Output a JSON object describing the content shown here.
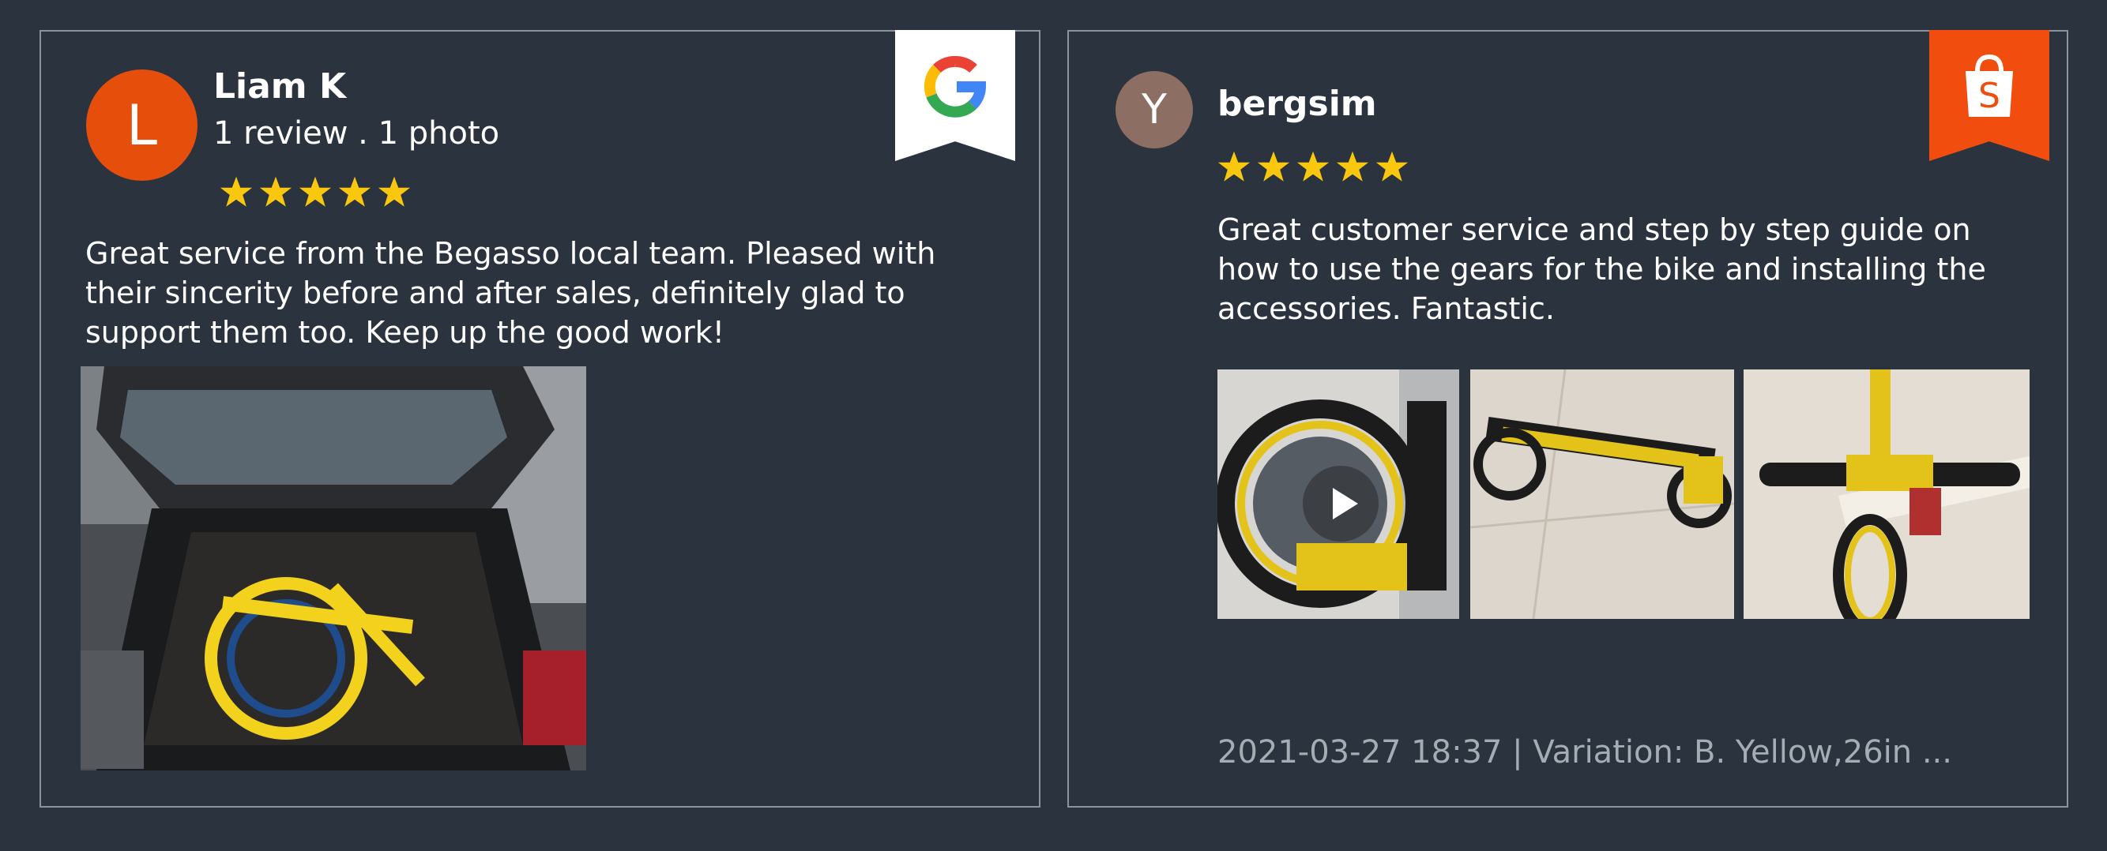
{
  "reviews": {
    "left": {
      "platform": "google",
      "avatar_letter": "L",
      "avatar_color": "#e64e0c",
      "name": "Liam K",
      "meta": "1 review . 1 photo",
      "rating": 5,
      "text": "Great service from the Begasso local team. Pleased with their sincerity before and after sales, definitely glad to support them too. Keep up the good work!",
      "photo": "photo of folded yellow bicycle in car trunk"
    },
    "right": {
      "platform": "shopee",
      "avatar_letter": "Y",
      "avatar_color": "#8c6e63",
      "name": "bergsim",
      "rating": 5,
      "text": "Great customer service and step by step guide on how to use the gears for the bike and installing the accessories. Fantastic.",
      "media": [
        "video thumbnail of yellow bicycle wheel",
        "photo of yellow bicycle frame",
        "photo of yellow bicycle handlebar"
      ],
      "footer": "2021-03-27 18:37 | Variation: B. Yellow,26in ..."
    }
  },
  "colors": {
    "background": "#2b333e",
    "border": "#8a939e",
    "star": "#f9c80e",
    "shopee": "#f04d0f"
  }
}
